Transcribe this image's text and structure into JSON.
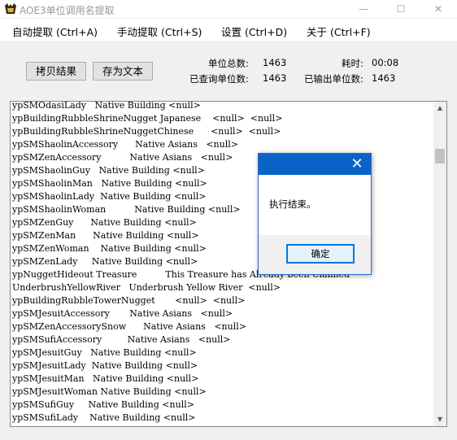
{
  "window": {
    "title": "AOE3单位调用名提取",
    "minimize": "—",
    "maximize": "☐",
    "close": "✕"
  },
  "menu": [
    {
      "label": "自动提取 (Ctrl+A)"
    },
    {
      "label": "手动提取 (Ctrl+S)"
    },
    {
      "label": "设置 (Ctrl+D)"
    },
    {
      "label": "关于 (Ctrl+F)"
    }
  ],
  "toolbar": {
    "copy_label": "拷贝结果",
    "save_label": "存为文本"
  },
  "stats": {
    "total_label": "单位总数:",
    "total_value": "1463",
    "time_label": "耗时:",
    "time_value": "00:08",
    "queried_label": "已查询单位数:",
    "queried_value": "1463",
    "output_label": "已输出单位数:",
    "output_value": "1463"
  },
  "rows": [
    "ypSMOdasiLady   Native Building <null>",
    "ypBuildingRubbleShrineNugget Japanese    <null>  <null>",
    "ypBuildingRubbleShrineNuggetChinese      <null>  <null>",
    "ypSMShaolinAccessory      Native Asians   <null>",
    "ypSMZenAccessory          Native Asians   <null>",
    "ypSMShaolinGuy   Native Building <null>",
    "ypSMShaolinMan   Native Building <null>",
    "ypSMShaolinLady  Native Building <null>",
    "ypSMShaolinWoman          Native Building <null>",
    "ypSMZenGuy      Native Building <null>",
    "ypSMZenMan      Native Building <null>",
    "ypSMZenWoman    Native Building <null>",
    "ypSMZenLady     Native Building <null>",
    "ypNuggetHideout Treasure          This Treasure has Already been Claimed",
    "UnderbrushYellowRiver   Underbrush Yellow River  <null>",
    "ypBuildingRubbleTowerNugget       <null>  <null>",
    "ypSMJesuitAccessory       Native Asians   <null>",
    "ypSMZenAccessorySnow      Native Asians   <null>",
    "ypSMSufiAccessory         Native Asians   <null>",
    "ypSMJesuitGuy   Native Building <null>",
    "ypSMJesuitLady  Native Building <null>",
    "ypSMJesuitMan   Native Building <null>",
    "ypSMJesuitWoman Native Building <null>",
    "ypSMSufiGuy     Native Building <null>",
    "ypSMSufiLady    Native Building <null>"
  ],
  "dialog": {
    "close": "✕",
    "message": "执行结束。",
    "ok_label": "确定"
  },
  "scrollbar": {
    "up": "▲",
    "down": "▼"
  }
}
